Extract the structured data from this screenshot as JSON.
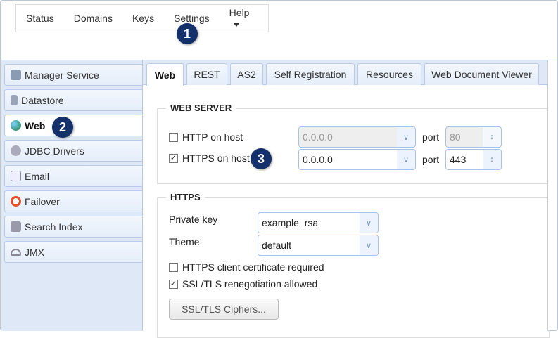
{
  "menu": {
    "items": [
      "Status",
      "Domains",
      "Keys",
      "Settings",
      "Help"
    ]
  },
  "callouts": [
    "1",
    "2",
    "3"
  ],
  "sidebar": {
    "items": [
      {
        "label": "Manager Service",
        "icon": "server-icon"
      },
      {
        "label": "Datastore",
        "icon": "database-icon"
      },
      {
        "label": "Web",
        "icon": "globe-icon",
        "active": true
      },
      {
        "label": "JDBC Drivers",
        "icon": "gears-icon"
      },
      {
        "label": "Email",
        "icon": "envelope-icon"
      },
      {
        "label": "Failover",
        "icon": "lifebuoy-icon"
      },
      {
        "label": "Search Index",
        "icon": "search-index-icon"
      },
      {
        "label": "JMX",
        "icon": "gauge-icon"
      }
    ]
  },
  "tabs": [
    "Web",
    "REST",
    "AS2",
    "Self Registration",
    "Resources",
    "Web Document Viewer"
  ],
  "web_server": {
    "title": "WEB SERVER",
    "http": {
      "label": "HTTP on host",
      "checked": false,
      "host": "0.0.0.0",
      "port_label": "port",
      "port": "80"
    },
    "https": {
      "label": "HTTPS on host",
      "checked": true,
      "host": "0.0.0.0",
      "port_label": "port",
      "port": "443"
    }
  },
  "https": {
    "title": "HTTPS",
    "private_key_label": "Private key",
    "private_key": "example_rsa",
    "theme_label": "Theme",
    "theme": "default",
    "client_cert_label": "HTTPS client certificate required",
    "client_cert": false,
    "reneg_label": "SSL/TLS renegotiation allowed",
    "reneg": true,
    "ciphers_button": "SSL/TLS Ciphers..."
  },
  "colors": {
    "accent": "#14306a",
    "sidebar_bg": "#dfe8f6"
  }
}
